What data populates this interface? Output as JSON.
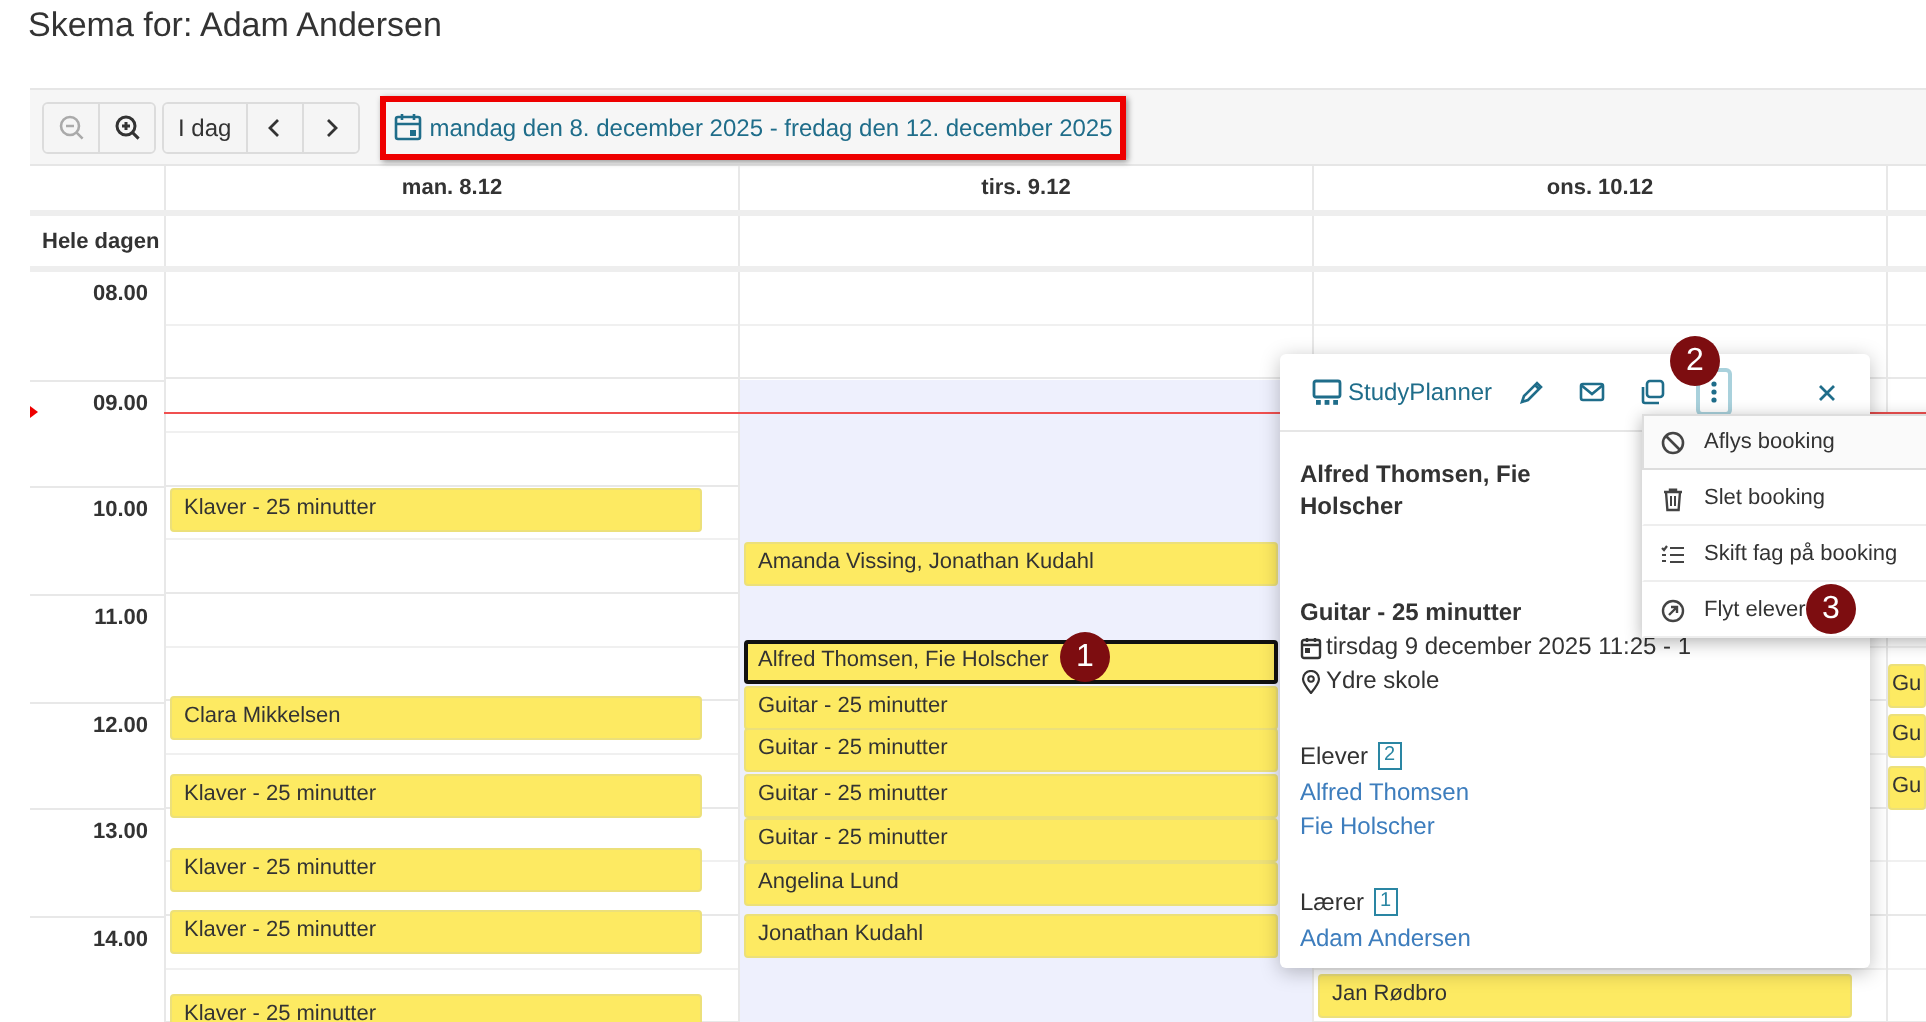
{
  "page_title": "Skema for: Adam Andersen",
  "toolbar": {
    "zoom_buttons": [
      {
        "kind": "zoom-out",
        "disabled": true
      },
      {
        "kind": "zoom-in",
        "disabled": false
      }
    ],
    "today_button": "I dag",
    "nav_buttons": [
      {
        "kind": "prev"
      },
      {
        "kind": "next"
      }
    ],
    "date_range": {
      "label": "mandag den 8. december 2025 - fredag den 12. december 2025",
      "highlighted": true
    }
  },
  "calendar": {
    "all_day_label": "Hele dagen",
    "hours": [
      "08.00",
      "09.00",
      "10.00",
      "11.00",
      "12.00",
      "13.00",
      "14.00"
    ],
    "days": [
      {
        "label": "man. 8.12",
        "highlighted": false,
        "events": [
          {
            "title": "Klaver - 25 minutter",
            "selected": false
          },
          {
            "title": "Clara Mikkelsen",
            "selected": false
          },
          {
            "title": "Klaver - 25 minutter",
            "selected": false
          },
          {
            "title": "Klaver - 25 minutter",
            "selected": false
          },
          {
            "title": "Klaver - 25 minutter",
            "selected": false
          },
          {
            "title": "Klaver - 25 minutter",
            "selected": false
          }
        ]
      },
      {
        "label": "tirs. 9.12",
        "highlighted": true,
        "events": [
          {
            "title": "Amanda Vissing, Jonathan Kudahl",
            "selected": false
          },
          {
            "title": "Alfred Thomsen, Fie Holscher",
            "selected": true
          },
          {
            "title": "Guitar - 25 minutter",
            "selected": false
          },
          {
            "title": "Guitar - 25 minutter",
            "selected": false
          },
          {
            "title": "Guitar - 25 minutter",
            "selected": false
          },
          {
            "title": "Guitar - 25 minutter",
            "selected": false
          },
          {
            "title": "Angelina Lund",
            "selected": false
          },
          {
            "title": "Jonathan Kudahl",
            "selected": false
          }
        ]
      },
      {
        "label": "ons. 10.12",
        "highlighted": false,
        "events": [
          {
            "title": "Jan Rødbro",
            "selected": false
          }
        ]
      },
      {
        "highlighted": false,
        "events": [
          {
            "title": "Gu",
            "selected": false
          },
          {
            "title": "Gu",
            "selected": false
          },
          {
            "title": "Gu",
            "selected": false
          }
        ]
      }
    ]
  },
  "popover": {
    "app_label": "StudyPlanner",
    "menu_expanded": true,
    "title": "Alfred Thomsen, Fie Holscher",
    "subject": "Guitar - 25 minutter",
    "when": "tirsdag 9 december 2025 11:25 - 1",
    "where": "Ydre skole",
    "groups": [
      {
        "label": "Elever",
        "count": "2",
        "names": [
          "Alfred Thomsen",
          "Fie Holscher"
        ]
      },
      {
        "label": "Lærer",
        "count": "1",
        "names": [
          "Adam Andersen"
        ]
      }
    ]
  },
  "menu": {
    "items": [
      {
        "label": "Aflys booking",
        "kind": "ban",
        "selected": true
      },
      {
        "label": "Slet booking",
        "kind": "trash",
        "selected": false
      },
      {
        "label": "Skift fag på booking",
        "kind": "list",
        "selected": false
      },
      {
        "label": "Flyt elever",
        "kind": "move",
        "selected": false
      }
    ]
  },
  "markers": [
    {
      "label": "1"
    },
    {
      "label": "2"
    },
    {
      "label": "3"
    }
  ]
}
